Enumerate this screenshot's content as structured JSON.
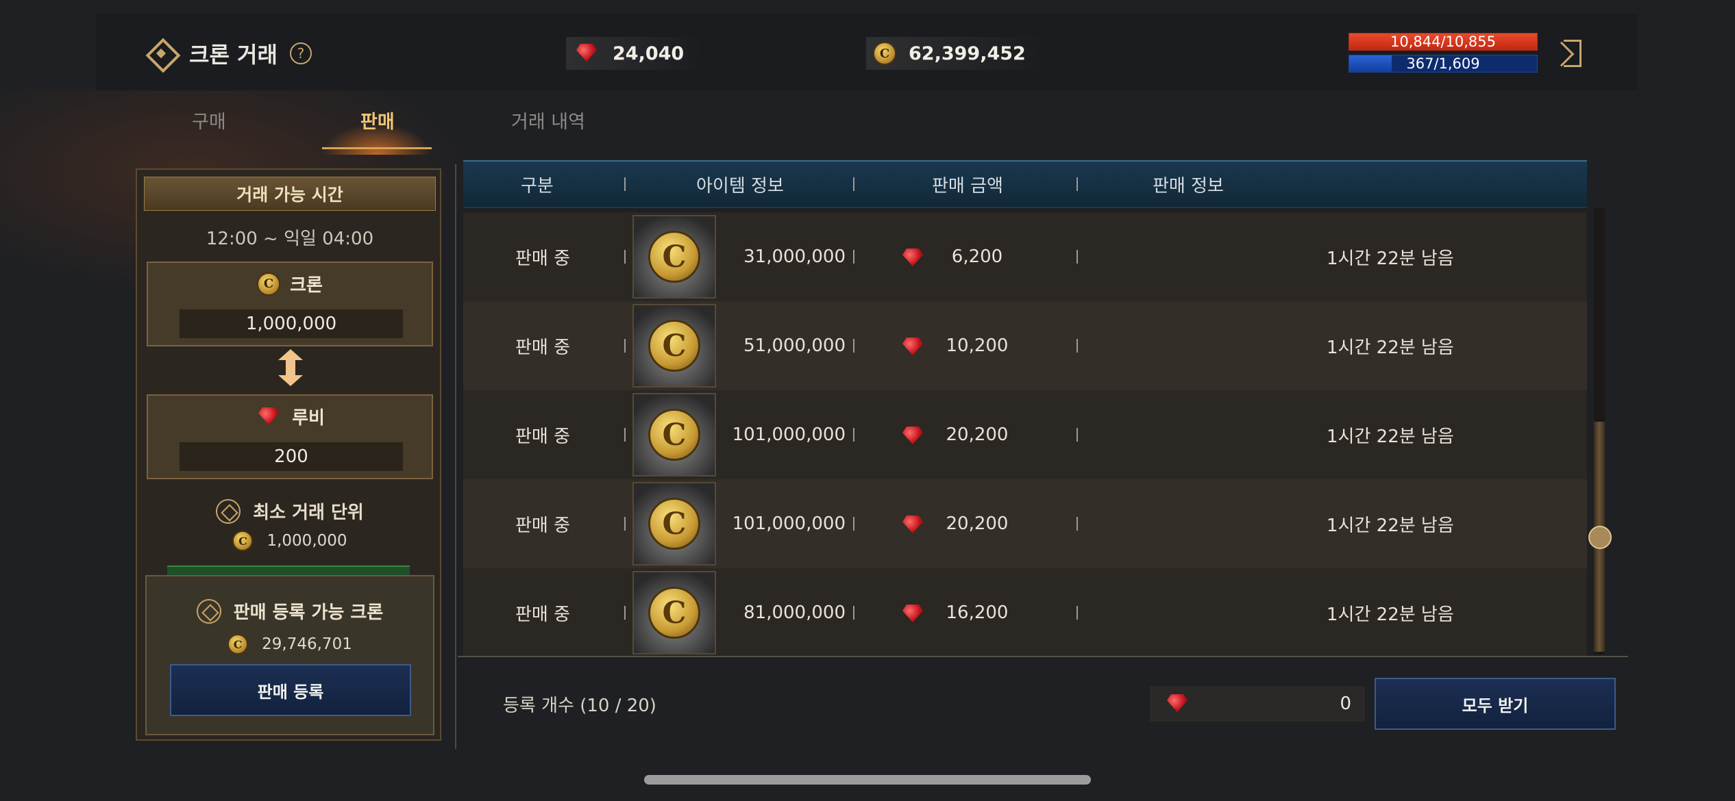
{
  "header": {
    "title": "크론 거래",
    "help": "?",
    "ruby_amount": "24,040",
    "kron_amount": "62,399,452",
    "hp": {
      "text": "10,844/10,855",
      "ratio": 0.999
    },
    "mp": {
      "text": "367/1,609",
      "ratio": 0.228
    }
  },
  "tabs": [
    {
      "label": "구매",
      "active": false
    },
    {
      "label": "판매",
      "active": true
    },
    {
      "label": "거래 내역",
      "active": false
    }
  ],
  "left_panel": {
    "trade_time_title": "거래 가능 시간",
    "trade_time": "12:00 ~ 익일 04:00",
    "kron_label": "크론",
    "kron_value": "1,000,000",
    "ruby_label": "루비",
    "ruby_value": "200",
    "min_unit_label": "최소 거래 단위",
    "min_unit_value": "1,000,000",
    "sellable_label": "판매 등록 가능 크론",
    "sellable_value": "29,746,701",
    "register_button": "판매 등록"
  },
  "table": {
    "headers": [
      "구분",
      "아이템 정보",
      "판매 금액",
      "판매 정보"
    ],
    "rows": [
      {
        "status": "판매 중",
        "amount": "31,000,000",
        "price": "6,200",
        "info": "1시간 22분 남음"
      },
      {
        "status": "판매 중",
        "amount": "51,000,000",
        "price": "10,200",
        "info": "1시간 22분 남음"
      },
      {
        "status": "판매 중",
        "amount": "101,000,000",
        "price": "20,200",
        "info": "1시간 22분 남음"
      },
      {
        "status": "판매 중",
        "amount": "101,000,000",
        "price": "20,200",
        "info": "1시간 22분 남음"
      },
      {
        "status": "판매 중",
        "amount": "81,000,000",
        "price": "16,200",
        "info": "1시간 22분 남음"
      }
    ]
  },
  "footer": {
    "count": "등록 개수 (10 / 20)",
    "total_ruby": "0",
    "claim_all_button": "모두 받기"
  },
  "icons": {
    "coin_glyph": "C"
  }
}
